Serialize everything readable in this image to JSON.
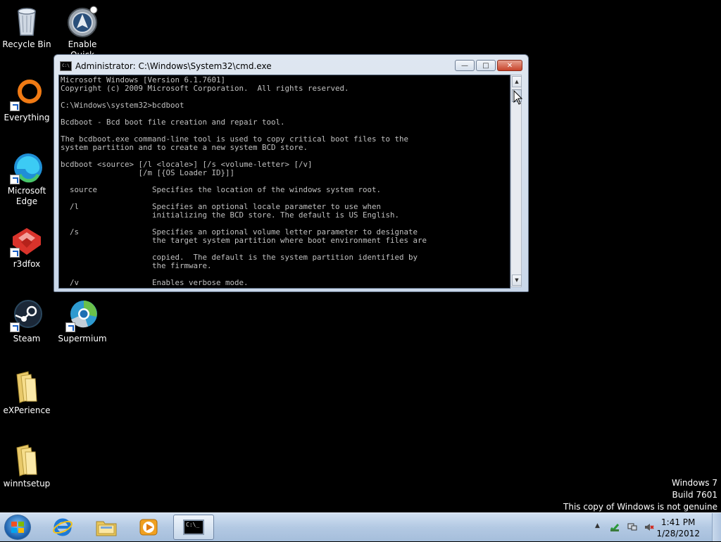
{
  "desktop": {
    "icons": [
      {
        "label": "Recycle Bin",
        "icon": "recycle-bin-icon"
      },
      {
        "label": "Enable Quick",
        "icon": "quick-launch-icon"
      },
      {
        "label": "Everything",
        "icon": "everything-icon"
      },
      {
        "label": "Microsoft Edge",
        "icon": "edge-icon"
      },
      {
        "label": "r3dfox",
        "icon": "r3dfox-icon"
      },
      {
        "label": "Steam",
        "icon": "steam-icon"
      },
      {
        "label": "Supermium",
        "icon": "supermium-icon"
      },
      {
        "label": "eXPerience",
        "icon": "folder-icon"
      },
      {
        "label": "winntsetup",
        "icon": "folder-icon"
      }
    ]
  },
  "window": {
    "title": "Administrator: C:\\Windows\\System32\\cmd.exe",
    "icon_text": "C:\\",
    "buttons": {
      "minimize": "—",
      "maximize": "□",
      "close": "✕"
    },
    "console_lines": [
      "Microsoft Windows [Version 6.1.7601]",
      "Copyright (c) 2009 Microsoft Corporation.  All rights reserved.",
      "",
      "C:\\Windows\\system32>bcdboot",
      "",
      "Bcdboot - Bcd boot file creation and repair tool.",
      "",
      "The bcdboot.exe command-line tool is used to copy critical boot files to the",
      "system partition and to create a new system BCD store.",
      "",
      "bcdboot <source> [/l <locale>] [/s <volume-letter> [/v]",
      "                 [/m [{OS Loader ID}]]",
      "",
      "  source            Specifies the location of the windows system root.",
      "",
      "  /l                Specifies an optional locale parameter to use when",
      "                    initializing the BCD store. The default is US English.",
      "",
      "  /s                Specifies an optional volume letter parameter to designate",
      "                    the target system partition where boot environment files are",
      "",
      "                    copied.  The default is the system partition identified by",
      "                    the firmware.",
      "",
      "  /v                Enables verbose mode."
    ]
  },
  "watermark": {
    "line1": "Windows 7",
    "line2": "Build 7601",
    "line3": "This copy of Windows is not genuine"
  },
  "taskbar": {
    "pinned": [
      "start-orb-icon",
      "internet-explorer-icon",
      "file-explorer-icon",
      "media-player-icon",
      "cmd-icon"
    ],
    "cmd_icon_text": "C:\\_",
    "show_hidden_icons": "▲",
    "time": "1:41 PM",
    "date": "1/28/2012"
  },
  "colors": {
    "desktop_bg": "#000000",
    "console_text": "#c0c0c0",
    "taskbar": "#b3c9e3"
  }
}
